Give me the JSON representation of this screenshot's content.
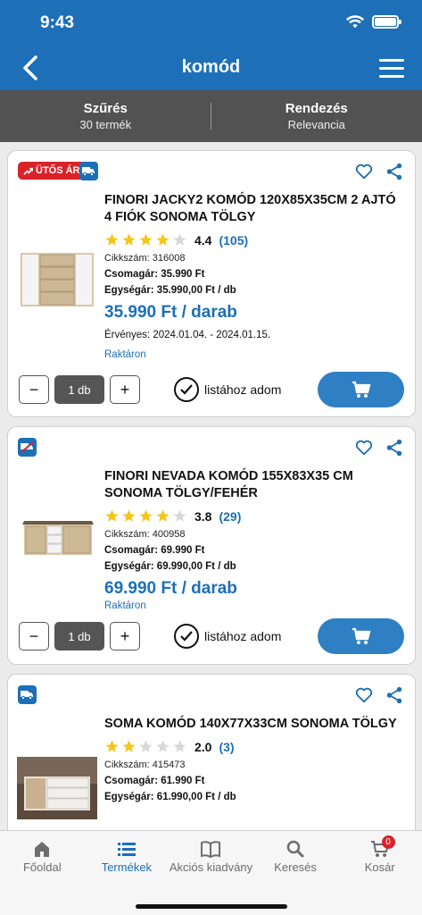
{
  "status": {
    "time": "9:43"
  },
  "header": {
    "title": "komód"
  },
  "filter": {
    "label": "Szűrés",
    "count": "30 termék"
  },
  "sort": {
    "label": "Rendezés",
    "value": "Relevancia"
  },
  "colors": {
    "brand": "#1d6fb8",
    "sale": "#d8232a",
    "star": "#f5c518"
  },
  "products": [
    {
      "badge": "ÜTŐS ÁR",
      "name": "FINORI JACKY2 KOMÓD 120X85X35CM 2 AJTÓ 4 FIÓK SONOMA TÖLGY",
      "rating": 4.4,
      "rating_text": "4.4",
      "reviews": "(105)",
      "sku": "Cikkszám: 316008",
      "package_price": "Csomagár: 35.990 Ft",
      "unit_price": "Egységár: 35.990,00 Ft / db",
      "price": "35.990 Ft / darab",
      "valid": "Érvényes: 2024.01.04. - 2024.01.15.",
      "stock": "Raktáron",
      "qty": "1 db",
      "list_label": "listához adom"
    },
    {
      "name": "FINORI NEVADA KOMÓD 155X83X35 CM SONOMA TÖLGY/FEHÉR",
      "rating": 3.8,
      "rating_text": "3.8",
      "reviews": "(29)",
      "sku": "Cikkszám: 400958",
      "package_price": "Csomagár: 69.990 Ft",
      "unit_price": "Egységár: 69.990,00 Ft / db",
      "price": "69.990 Ft / darab",
      "stock": "Raktáron",
      "qty": "1 db",
      "list_label": "listához adom"
    },
    {
      "name": "SOMA KOMÓD 140X77X33CM SONOMA TÖLGY",
      "rating": 2.0,
      "rating_text": "2.0",
      "reviews": "(3)",
      "sku": "Cikkszám: 415473",
      "package_price": "Csomagár: 61.990 Ft",
      "unit_price": "Egységár: 61.990,00 Ft / db"
    }
  ],
  "tabbar": {
    "items": [
      {
        "label": "Főoldal",
        "icon": "home-icon"
      },
      {
        "label": "Termékek",
        "icon": "list-icon"
      },
      {
        "label": "Akciós kiadvány",
        "icon": "book-icon"
      },
      {
        "label": "Keresés",
        "icon": "search-icon"
      },
      {
        "label": "Kosár",
        "icon": "cart-icon"
      }
    ],
    "active": "Termékek",
    "cart_count": "0"
  }
}
